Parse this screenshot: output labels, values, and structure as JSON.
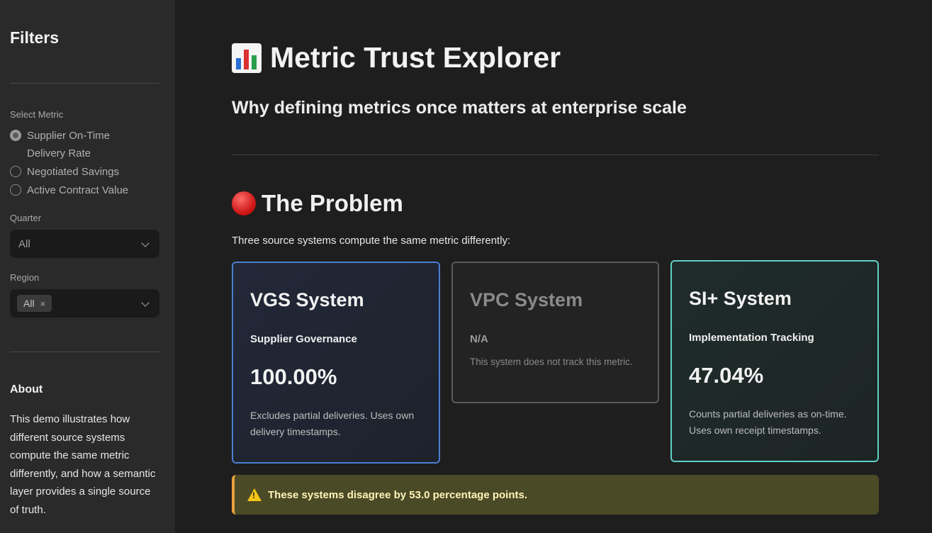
{
  "sidebar": {
    "title": "Filters",
    "metric_label": "Select Metric",
    "metrics": [
      {
        "label": "Supplier On-Time Delivery Rate",
        "selected": true
      },
      {
        "label": "Negotiated Savings",
        "selected": false
      },
      {
        "label": "Active Contract Value",
        "selected": false
      }
    ],
    "quarter_label": "Quarter",
    "quarter_value": "All",
    "region_label": "Region",
    "region_tag": "All",
    "region_tag_remove": "×",
    "about_title": "About",
    "about_text": "This demo illustrates how different source systems compute the same metric differently, and how a semantic layer provides a single source of truth."
  },
  "main": {
    "title": "Metric Trust Explorer",
    "subtitle": "Why defining metrics once matters at enterprise scale",
    "problem_title": "The Problem",
    "intro": "Three source systems compute the same metric differently:",
    "cards": [
      {
        "name": "VGS System",
        "subtitle": "Supplier Governance",
        "value": "100.00%",
        "note": "Excludes partial deliveries. Uses own delivery timestamps."
      },
      {
        "name": "VPC System",
        "subtitle": "N/A",
        "note": "This system does not track this metric."
      },
      {
        "name": "SI+ System",
        "subtitle": "Implementation Tracking",
        "value": "47.04%",
        "note": "Counts partial deliveries as on-time. Uses own receipt timestamps."
      }
    ],
    "warning": "These systems disagree by 53.0 percentage points."
  },
  "colors": {
    "vgs_border": "#4a7fd1",
    "si_border": "#5fd0c4",
    "warning_bar": "#e8a23a"
  },
  "icons": [
    "bar-chart-icon",
    "red-circle-icon",
    "warning-icon",
    "chevron-down-icon"
  ]
}
